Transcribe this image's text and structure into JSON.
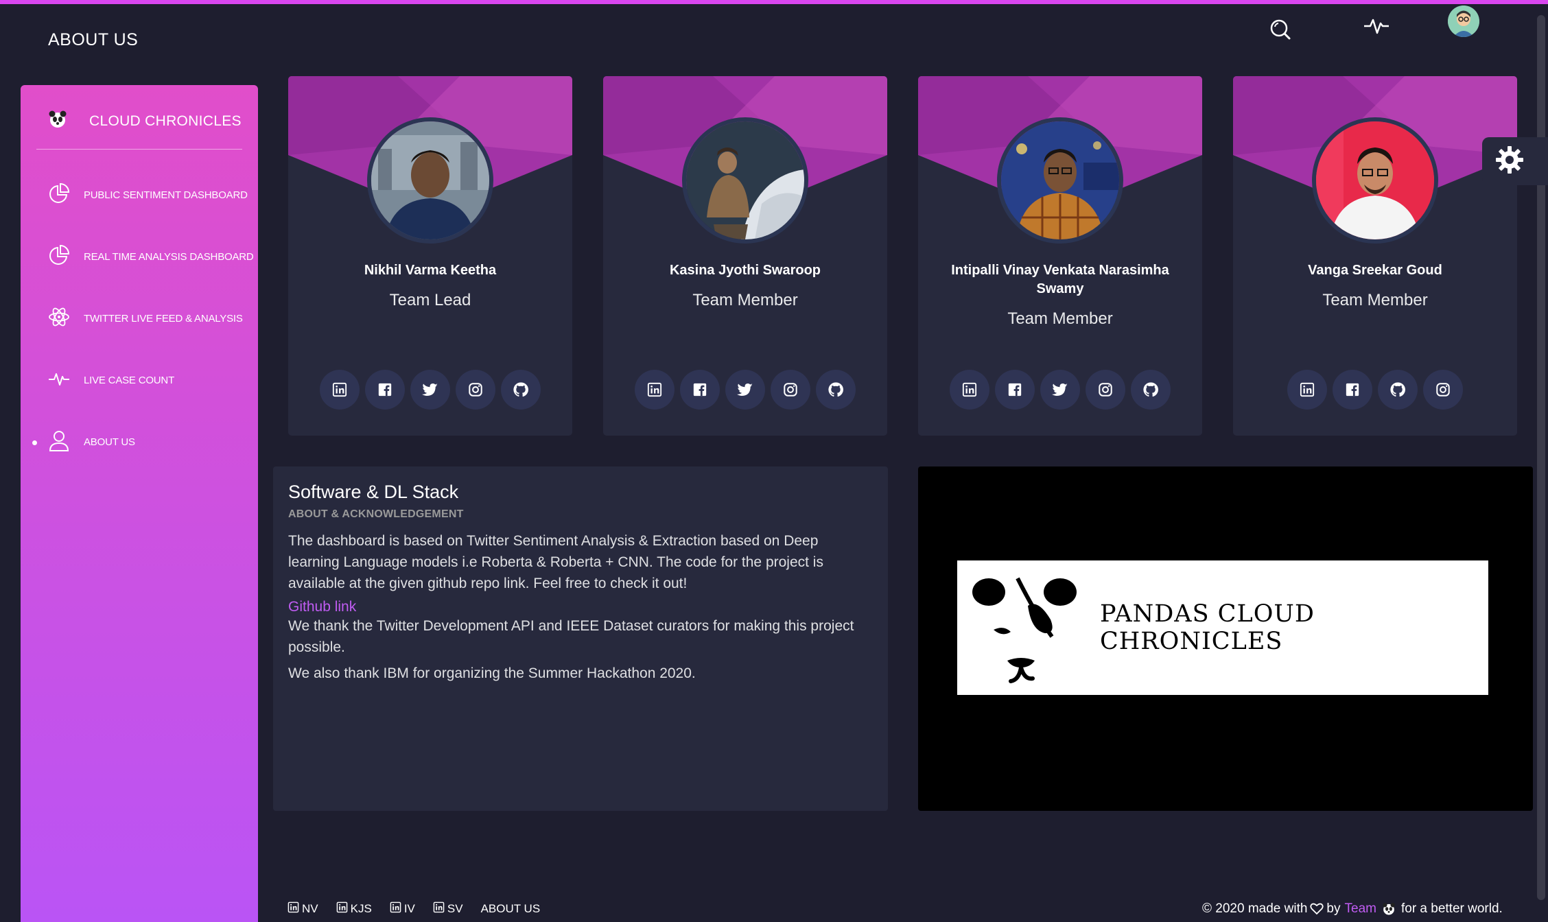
{
  "header": {
    "page_title": "ABOUT US"
  },
  "sidebar": {
    "brand": "CLOUD CHRONICLES",
    "items": [
      {
        "label": "PUBLIC SENTIMENT DASHBOARD",
        "icon": "pie-chart-icon"
      },
      {
        "label": "REAL TIME ANALYSIS DASHBOARD",
        "icon": "pie-chart-icon"
      },
      {
        "label": "TWITTER LIVE FEED & ANALYSIS",
        "icon": "atom-icon"
      },
      {
        "label": "LIVE CASE COUNT",
        "icon": "pulse-icon"
      },
      {
        "label": "ABOUT US",
        "icon": "user-icon",
        "active": true
      }
    ]
  },
  "team": [
    {
      "name": "Nikhil Varma Keetha",
      "role": "Team Lead",
      "socials": [
        "linkedin",
        "facebook",
        "twitter",
        "instagram",
        "github"
      ]
    },
    {
      "name": "Kasina Jyothi Swaroop",
      "role": "Team Member",
      "socials": [
        "linkedin",
        "facebook",
        "twitter",
        "instagram",
        "github"
      ]
    },
    {
      "name": "Intipalli Vinay Venkata Narasimha Swamy",
      "role": "Team Member",
      "socials": [
        "linkedin",
        "facebook",
        "twitter",
        "instagram",
        "github"
      ]
    },
    {
      "name": "Vanga Sreekar Goud",
      "role": "Team Member",
      "socials": [
        "linkedin",
        "facebook",
        "github",
        "instagram"
      ]
    }
  ],
  "about": {
    "title": "Software & DL Stack",
    "subtitle": "ABOUT & ACKNOWLEDGEMENT",
    "paragraph1": "The dashboard is based on Twitter Sentiment Analysis & Extraction based on Deep learning Language models i.e Roberta & Roberta + CNN. The code for the project is available at the given github repo link. Feel free to check it out!",
    "link_label": "Github link",
    "paragraph2": "We thank the Twitter Development API and IEEE Dataset curators for making this project possible.",
    "paragraph3": "We also thank IBM for organizing the Summer Hackathon 2020."
  },
  "logo": {
    "text": "PANDAS CLOUD CHRONICLES"
  },
  "footer": {
    "links": [
      "NV",
      "KJS",
      "IV",
      "SV"
    ],
    "about_link": "ABOUT US",
    "copyright_prefix": "© 2020 made with",
    "copyright_by": "by",
    "team_link": "Team",
    "copyright_suffix": "for a better world."
  },
  "colors": {
    "accent": "#e14eca",
    "accent2": "#ba54f5",
    "card": "#27293d",
    "background": "#1e1e2f",
    "link": "#c05cf2"
  }
}
